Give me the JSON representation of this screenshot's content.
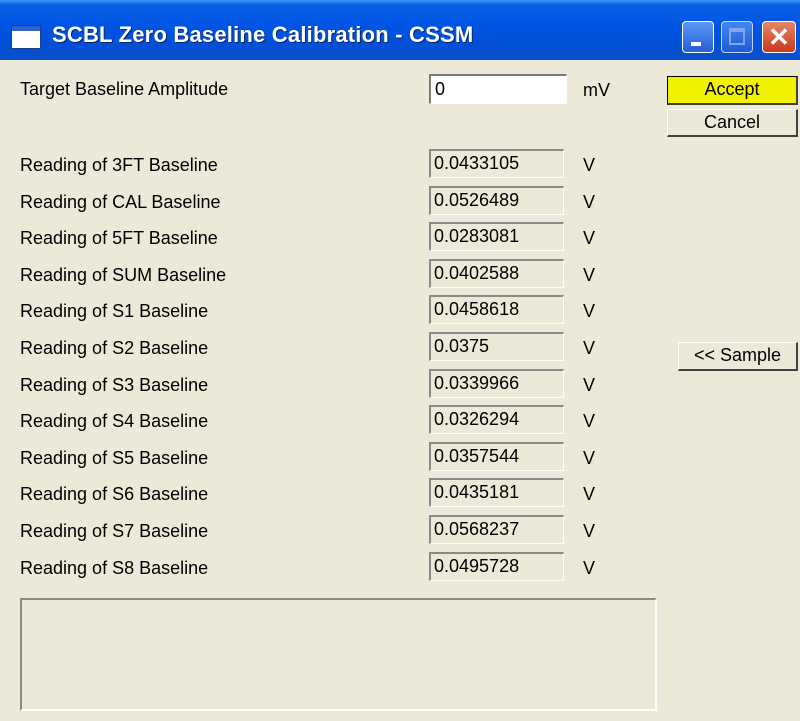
{
  "window": {
    "title": "SCBL Zero Baseline Calibration - CSSM",
    "close_glyph": "✕"
  },
  "target": {
    "label": "Target Baseline Amplitude",
    "value": "0",
    "unit": "mV"
  },
  "buttons": {
    "accept": "Accept",
    "cancel": "Cancel",
    "sample": "<< Sample"
  },
  "readings": [
    {
      "label": "Reading of 3FT Baseline",
      "value": "0.0433105",
      "unit": "V"
    },
    {
      "label": "Reading of CAL Baseline",
      "value": "0.0526489",
      "unit": "V"
    },
    {
      "label": "Reading of 5FT Baseline",
      "value": "0.0283081",
      "unit": "V"
    },
    {
      "label": "Reading of SUM Baseline",
      "value": "0.0402588",
      "unit": "V"
    },
    {
      "label": "Reading of S1 Baseline",
      "value": "0.0458618",
      "unit": "V"
    },
    {
      "label": "Reading of S2 Baseline",
      "value": "0.0375",
      "unit": "V"
    },
    {
      "label": "Reading of S3 Baseline",
      "value": "0.0339966",
      "unit": "V"
    },
    {
      "label": "Reading of S4 Baseline",
      "value": "0.0326294",
      "unit": "V"
    },
    {
      "label": "Reading of S5 Baseline",
      "value": "0.0357544",
      "unit": "V"
    },
    {
      "label": "Reading of S6 Baseline",
      "value": "0.0435181",
      "unit": "V"
    },
    {
      "label": "Reading of S7 Baseline",
      "value": "0.0568237",
      "unit": "V"
    },
    {
      "label": "Reading of S8 Baseline",
      "value": "0.0495728",
      "unit": "V"
    }
  ],
  "message": "",
  "colors": {
    "titlebar": "#0055e5",
    "dialog_bg": "#ece9d8",
    "accept_highlight": "#f2f200",
    "close_button": "#c8391b"
  }
}
